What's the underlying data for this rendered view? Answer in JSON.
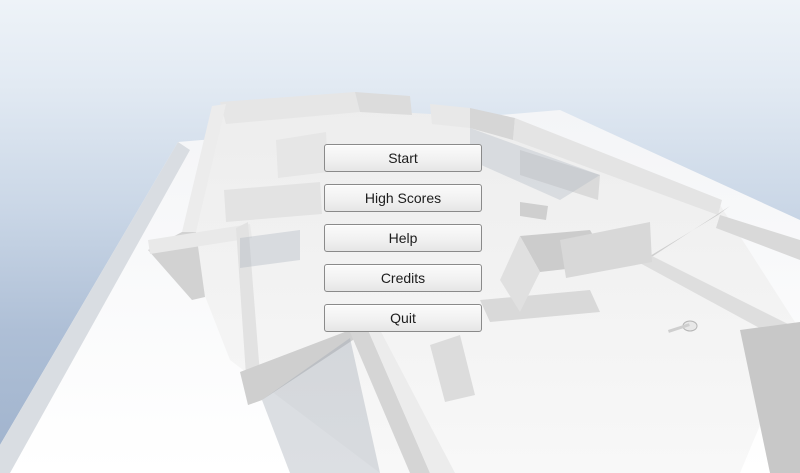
{
  "menu": {
    "buttons": [
      {
        "id": "start",
        "label": "Start"
      },
      {
        "id": "high-scores",
        "label": "High Scores"
      },
      {
        "id": "help",
        "label": "Help"
      },
      {
        "id": "credits",
        "label": "Credits"
      },
      {
        "id": "quit",
        "label": "Quit"
      }
    ]
  },
  "colors": {
    "sky_top": "#eef3f8",
    "sky_bottom": "#9fb2cc",
    "wall_light": "#f2f2f2",
    "wall_shade": "#c9c9c9",
    "floor": "#f7f7f7",
    "button_border": "#8a8a8a",
    "button_text": "#1c1c1c"
  }
}
